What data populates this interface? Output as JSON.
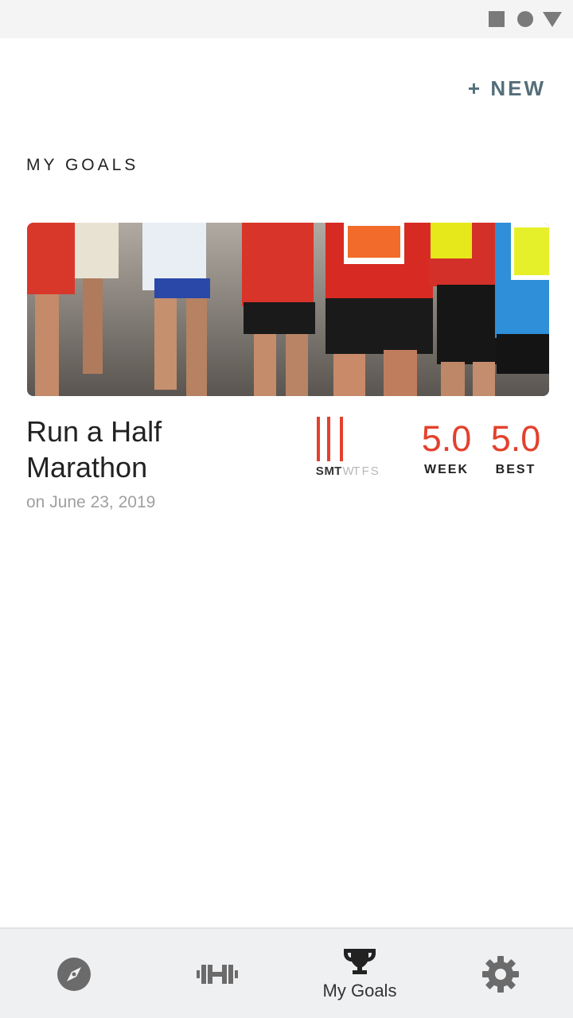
{
  "header": {
    "new_label": "+ NEW",
    "title": "MY GOALS"
  },
  "goal": {
    "image_alt": "marathon-runners-photo",
    "title": "Run a Half Marathon",
    "date": "on June 23, 2019",
    "days": [
      {
        "letter": "S",
        "active": true
      },
      {
        "letter": "M",
        "active": true
      },
      {
        "letter": "T",
        "active": true
      },
      {
        "letter": "W",
        "active": false
      },
      {
        "letter": "T",
        "active": false
      },
      {
        "letter": "F",
        "active": false
      },
      {
        "letter": "S",
        "active": false
      }
    ],
    "week_value": "5.0",
    "week_label": "WEEK",
    "best_value": "5.0",
    "best_label": "BEST"
  },
  "bottom_nav": {
    "items": [
      {
        "icon": "compass-icon",
        "label": ""
      },
      {
        "icon": "dumbbell-icon",
        "label": ""
      },
      {
        "icon": "trophy-icon",
        "label": "My Goals",
        "selected": true
      },
      {
        "icon": "gear-icon",
        "label": ""
      }
    ]
  },
  "colors": {
    "accent": "#e4402c",
    "new_button": "#546e7a",
    "nav_background": "#eef0f2"
  }
}
